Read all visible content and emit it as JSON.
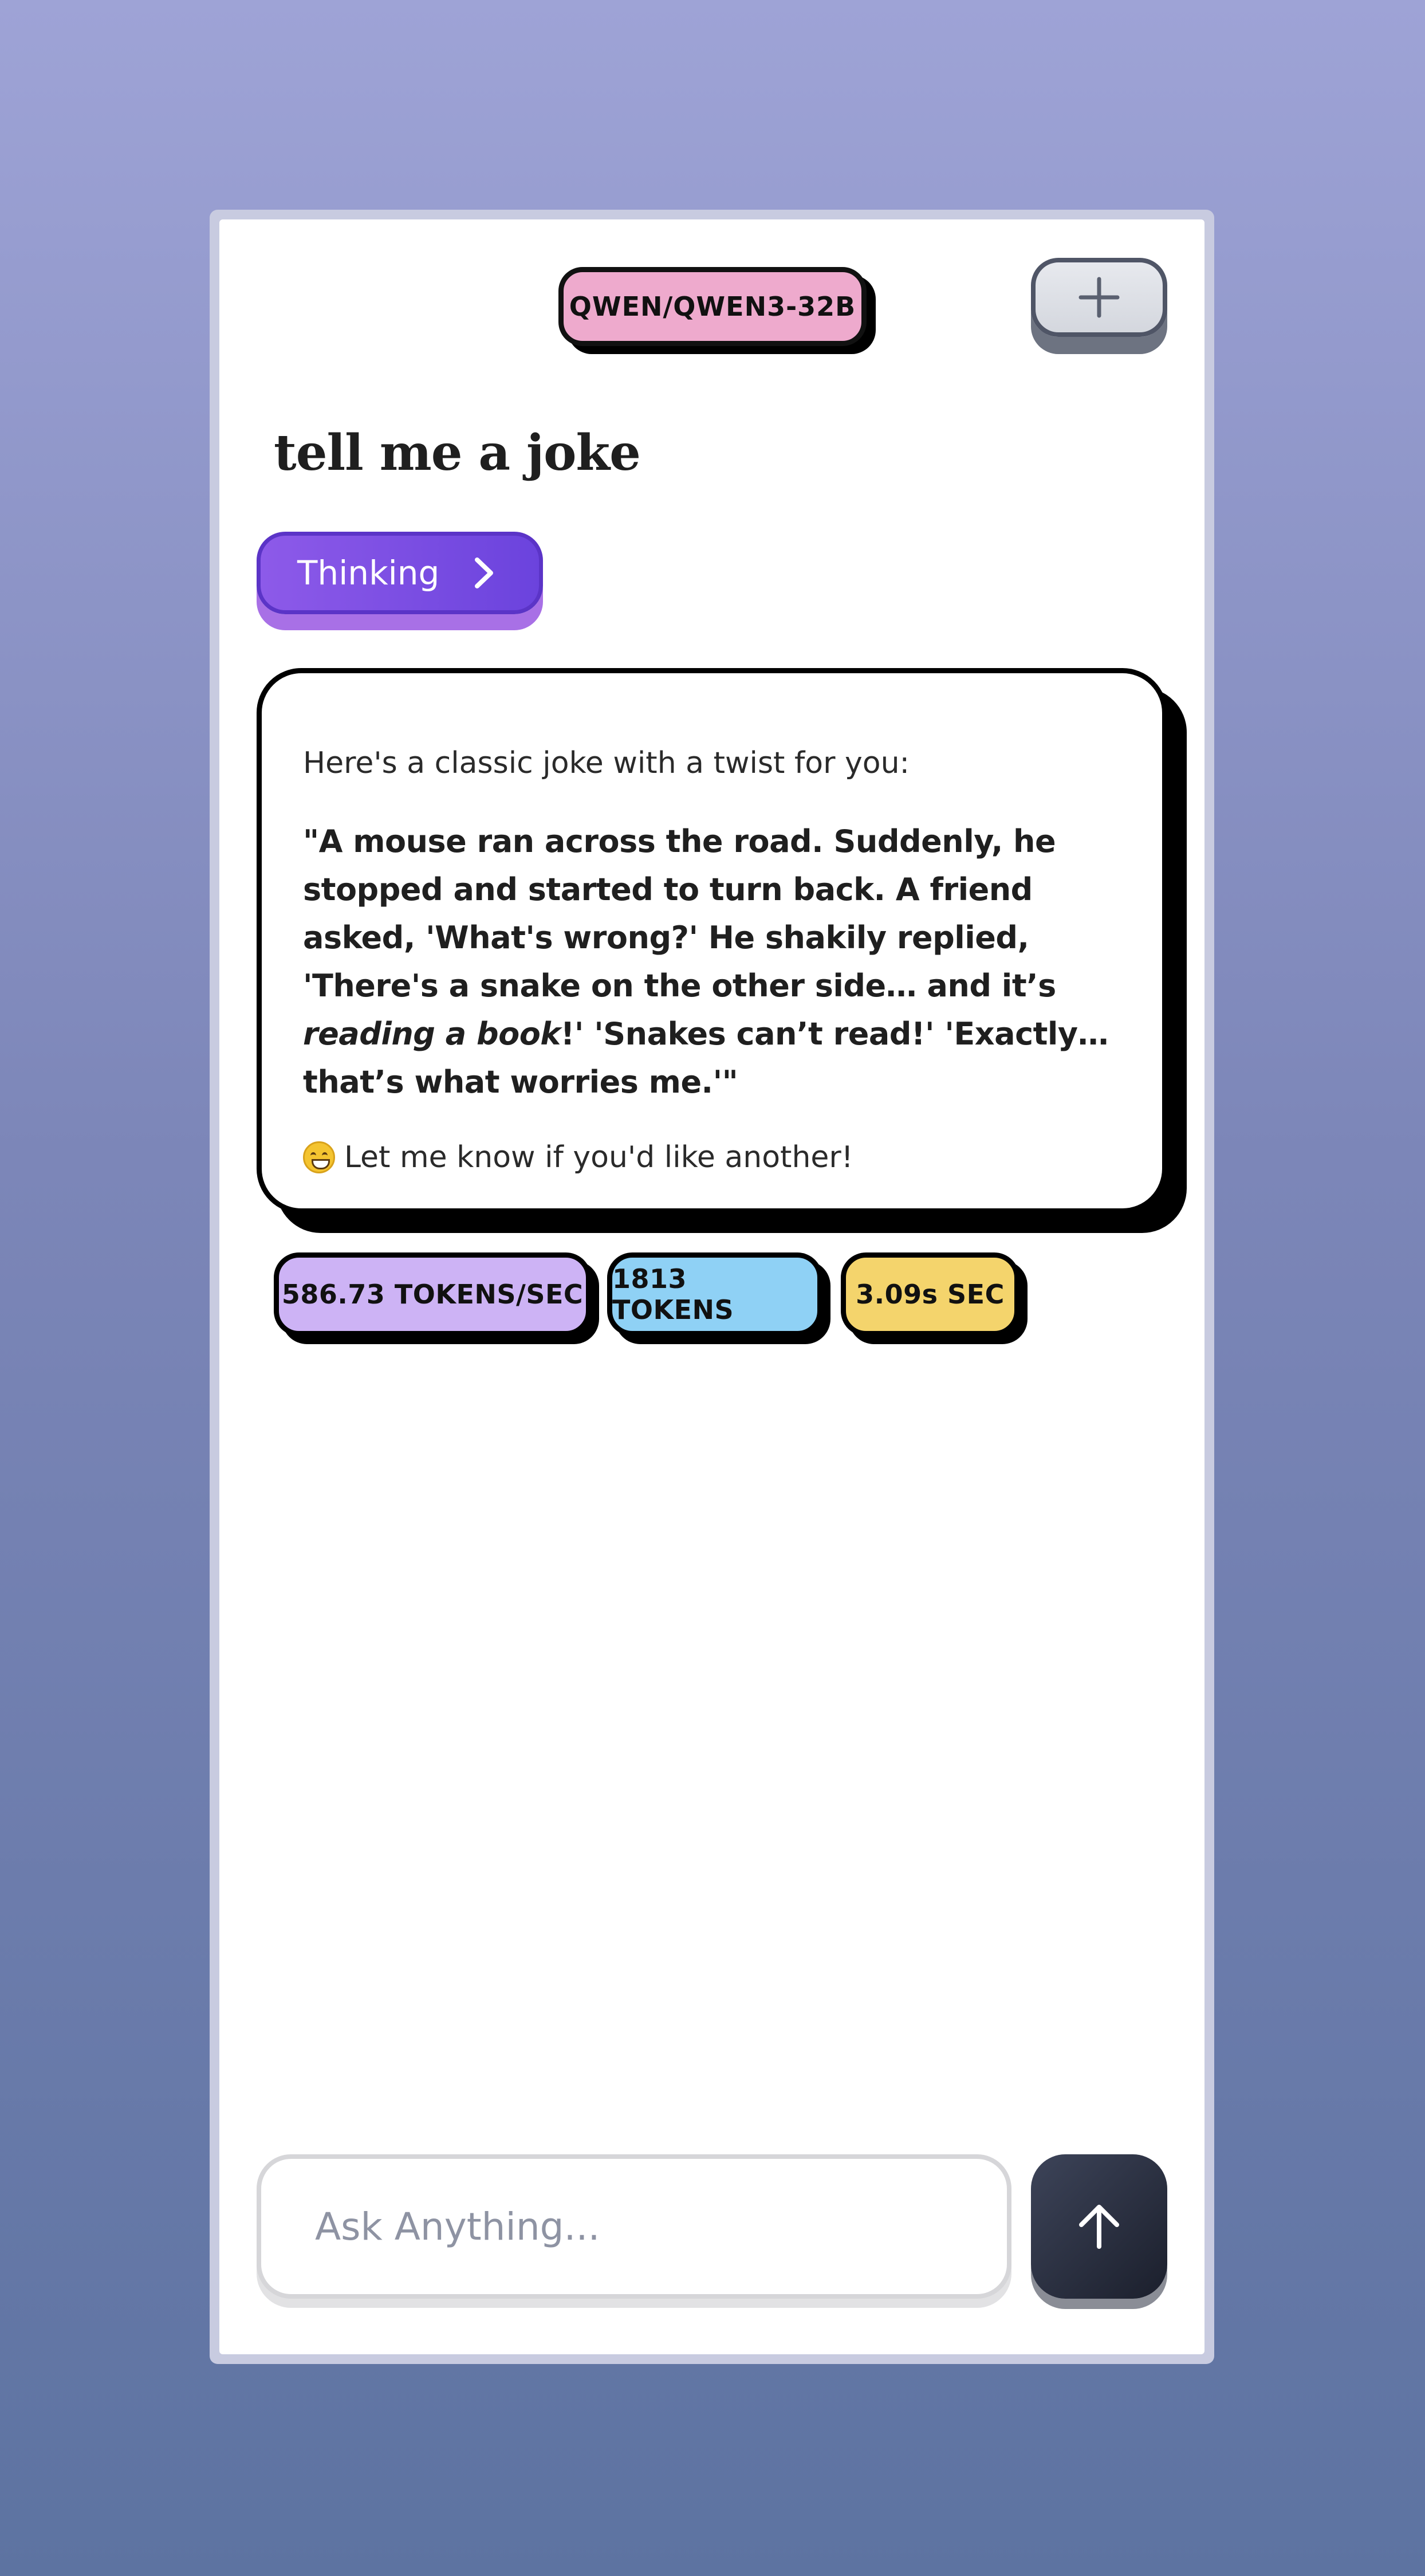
{
  "header": {
    "model_name": "QWEN/QWEN3-32B",
    "new_chat_icon": "plus-icon"
  },
  "conversation": {
    "user_prompt": "tell me a joke",
    "thinking_label": "Thinking",
    "thinking_icon": "chevron-right-icon",
    "response": {
      "intro": "Here's a classic joke with a twist for you:",
      "joke_part1": "\"A mouse ran across the road. Suddenly, he stopped and started to turn back. A friend asked, 'What's wrong?' He shakily replied, 'There's a snake on the other side… and it’s ",
      "joke_emphasis": "reading a book",
      "joke_part2": "!' 'Snakes can’t read!' 'Exactly… that’s what worries me.'\"",
      "outro_emoji": "grinning-face-emoji",
      "outro": "Let me know if you'd like another!"
    }
  },
  "stats": {
    "tokens_per_sec": "586.73 TOKENS/SEC",
    "tokens": "1813 TOKENS",
    "duration": "3.09s SEC"
  },
  "composer": {
    "placeholder": "Ask Anything...",
    "value": "",
    "send_icon": "arrow-up-icon"
  },
  "colors": {
    "model_pill": "#eeaacd",
    "thinking": "#7a4ee3",
    "tps_badge": "#cdb3f5",
    "tokens_badge": "#8fd1f5",
    "sec_badge": "#f4d46c",
    "send_button": "#252a3a"
  }
}
